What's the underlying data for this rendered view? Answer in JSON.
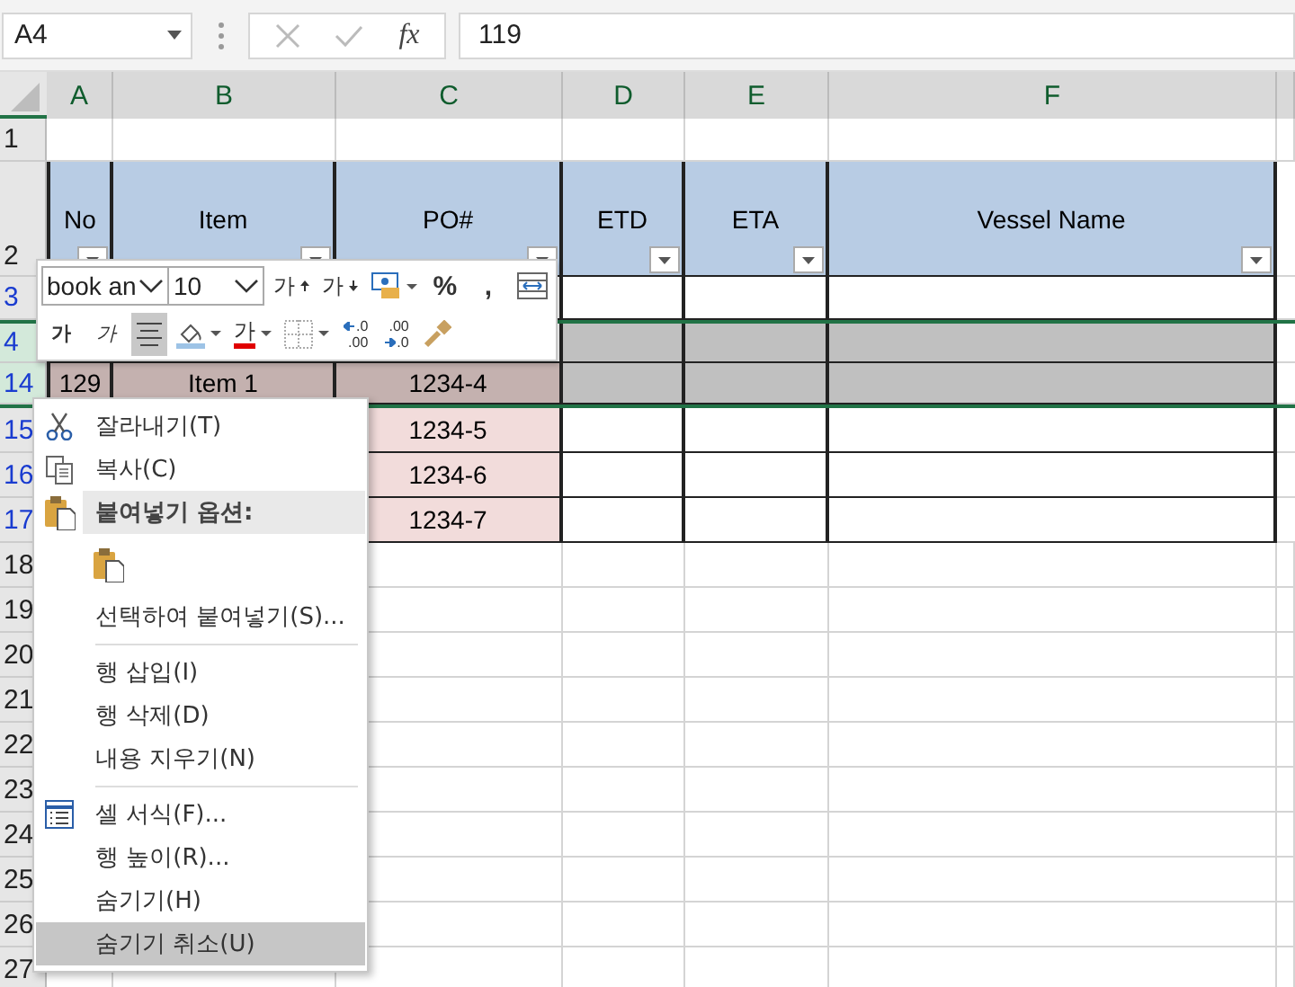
{
  "name_box": {
    "value": "A4"
  },
  "formula_bar": {
    "function_label": "fx",
    "value": "119"
  },
  "columns": [
    {
      "letter": "A"
    },
    {
      "letter": "B"
    },
    {
      "letter": "C"
    },
    {
      "letter": "D"
    },
    {
      "letter": "E"
    },
    {
      "letter": "F"
    }
  ],
  "rows": [
    {
      "number": "1",
      "kind": "plain",
      "filtered": false,
      "selected": false
    },
    {
      "number": "2",
      "kind": "header",
      "filtered": false,
      "selected": false,
      "cells": [
        {
          "color": "#b8cce4",
          "text": "No",
          "filter": true
        },
        {
          "color": "#b8cce4",
          "text": "Item",
          "filter": true
        },
        {
          "color": "#b8cce4",
          "text": "PO#",
          "filter": true
        },
        {
          "color": "#b8cce4",
          "text": "ETD",
          "filter": true
        },
        {
          "color": "#b8cce4",
          "text": "ETA",
          "filter": true
        },
        {
          "color": "#b8cce4",
          "text": "Vessel Name",
          "filter": true
        }
      ]
    },
    {
      "number": "3",
      "kind": "table",
      "filtered": true,
      "selected": false,
      "cells": [
        {},
        {},
        {},
        {
          "color": "#ffffff"
        },
        {
          "color": "#ffffff"
        },
        {
          "color": "#ffffff"
        }
      ]
    },
    {
      "number": "4",
      "kind": "table",
      "filtered": true,
      "selected": true,
      "cells": [
        {},
        {},
        {},
        {
          "color": "#c0c0c0"
        },
        {
          "color": "#c0c0c0"
        },
        {
          "color": "#c0c0c0"
        }
      ]
    },
    {
      "number": "14",
      "kind": "table",
      "filtered": true,
      "selected": true,
      "cells": [
        {
          "color": "#c4b1af",
          "text": "129"
        },
        {
          "color": "#c4b1af",
          "text": "Item 1"
        },
        {
          "color": "#c4b1af",
          "text": "1234-4"
        },
        {
          "color": "#c0c0c0"
        },
        {
          "color": "#c0c0c0"
        },
        {
          "color": "#c0c0c0"
        }
      ]
    },
    {
      "number": "15",
      "kind": "table",
      "filtered": true,
      "selected": false,
      "cells": [
        {},
        {},
        {
          "color": "#f2dcdb",
          "text": "1234-5"
        },
        {
          "color": "#ffffff"
        },
        {
          "color": "#ffffff"
        },
        {
          "color": "#ffffff"
        }
      ]
    },
    {
      "number": "16",
      "kind": "table",
      "filtered": true,
      "selected": false,
      "cells": [
        {},
        {},
        {
          "color": "#f2dcdb",
          "text": "1234-6"
        },
        {
          "color": "#ffffff"
        },
        {
          "color": "#ffffff"
        },
        {
          "color": "#ffffff"
        }
      ]
    },
    {
      "number": "17",
      "kind": "table",
      "filtered": true,
      "selected": false,
      "cells": [
        {},
        {},
        {
          "color": "#f2dcdb",
          "text": "1234-7"
        },
        {
          "color": "#ffffff"
        },
        {
          "color": "#ffffff"
        },
        {
          "color": "#ffffff"
        }
      ]
    },
    {
      "number": "18",
      "kind": "plain",
      "filtered": false,
      "selected": false
    },
    {
      "number": "19",
      "kind": "plain",
      "filtered": false,
      "selected": false
    },
    {
      "number": "20",
      "kind": "plain",
      "filtered": false,
      "selected": false
    },
    {
      "number": "21",
      "kind": "plain",
      "filtered": false,
      "selected": false
    },
    {
      "number": "22",
      "kind": "plain",
      "filtered": false,
      "selected": false
    },
    {
      "number": "23",
      "kind": "plain",
      "filtered": false,
      "selected": false
    },
    {
      "number": "24",
      "kind": "plain",
      "filtered": false,
      "selected": false
    },
    {
      "number": "25",
      "kind": "plain",
      "filtered": false,
      "selected": false
    },
    {
      "number": "26",
      "kind": "plain",
      "filtered": false,
      "selected": false
    },
    {
      "number": "27",
      "kind": "plain",
      "filtered": false,
      "selected": false
    }
  ],
  "mini_toolbar": {
    "font_name": "book an",
    "font_size": "10",
    "row_1": [
      {
        "kind": "grow",
        "text": "가",
        "on": false
      },
      {
        "kind": "shrink",
        "text": "가",
        "on": false
      },
      {
        "kind": "accounting",
        "on": false
      },
      {
        "kind": "text",
        "text": "%",
        "on": false
      },
      {
        "kind": "text",
        "text": ",",
        "on": false
      },
      {
        "kind": "wrap",
        "on": false
      }
    ],
    "row_2": [
      {
        "kind": "bold",
        "text": "가",
        "on": false
      },
      {
        "kind": "italic",
        "text": "가",
        "on": false
      },
      {
        "kind": "align",
        "on": true
      },
      {
        "kind": "fill",
        "on": false
      },
      {
        "kind": "font_color",
        "text": "가",
        "on": false
      },
      {
        "kind": "borders",
        "on": false
      },
      {
        "kind": "decimal_more",
        "lines": [
          ".0",
          ".00"
        ],
        "on": false
      },
      {
        "kind": "decimal_less",
        "lines": [
          ".00",
          ".0"
        ],
        "on": false
      },
      {
        "kind": "painter",
        "on": false
      }
    ]
  },
  "context_menu": {
    "items": [
      {
        "kind": "cut",
        "text": "잘라내기(T)",
        "selected": false
      },
      {
        "kind": "copy",
        "text": "복사(C)",
        "selected": false
      },
      {
        "kind": "heading",
        "text": "붙여넣기 옵션:"
      },
      {
        "kind": "paste_option"
      },
      {
        "kind": "item",
        "text": "선택하여 붙여넣기(S)...",
        "selected": false
      },
      {
        "kind": "separator"
      },
      {
        "kind": "item",
        "text": "행 삽입(I)",
        "selected": false
      },
      {
        "kind": "item",
        "text": "행 삭제(D)",
        "selected": false
      },
      {
        "kind": "item",
        "text": "내용 지우기(N)",
        "selected": false
      },
      {
        "kind": "separator"
      },
      {
        "kind": "format",
        "text": "셀 서식(F)...",
        "selected": false
      },
      {
        "kind": "item",
        "text": "행 높이(R)...",
        "selected": false
      },
      {
        "kind": "item",
        "text": "숨기기(H)",
        "selected": false
      },
      {
        "kind": "item",
        "text": "숨기기 취소(U)",
        "selected": true
      }
    ]
  }
}
